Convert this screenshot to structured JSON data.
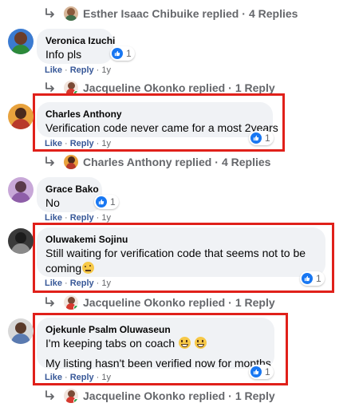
{
  "reply_summaries": [
    {
      "name": "Esther Isaac Chibuike replied",
      "count": "4 Replies"
    },
    {
      "name": "Jacqueline Okonko replied",
      "count": "1 Reply"
    },
    {
      "name": "Charles Anthony replied",
      "count": "4 Replies"
    },
    {
      "name": "Jacqueline Okonko replied",
      "count": "1 Reply"
    },
    {
      "name": "Jacqueline Okonko replied",
      "count": "1 Reply"
    }
  ],
  "actions": {
    "like": "Like",
    "reply": "Reply",
    "separator": "·"
  },
  "comments": [
    {
      "author": "Veronica Izuchi",
      "text": "Info pls",
      "reactions": "1",
      "age": "1y"
    },
    {
      "author": "Charles Anthony",
      "text": "Verification code never came for a most 2years",
      "reactions": "1",
      "age": "1y"
    },
    {
      "author": "Grace Bako",
      "text": "No",
      "reactions": "1",
      "age": "1y"
    },
    {
      "author": "Oluwakemi Sojinu",
      "text": "Still waiting for verification code that seems not to be coming",
      "reactions": "1",
      "age": "1y"
    },
    {
      "author": "Ojekunle Psalm Oluwaseun",
      "text": "I'm keeping tabs on coach",
      "text2": "My listing hasn't been verified now for months",
      "reactions": "1",
      "age": "1y"
    }
  ],
  "colors": {
    "highlight": "#e0201a",
    "bubble": "#f0f2f5",
    "like_blue": "#1877f2",
    "meta_gray": "#65676b"
  }
}
